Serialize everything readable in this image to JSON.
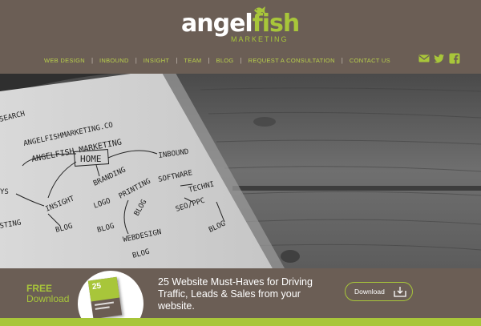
{
  "brand": {
    "name_part1": "angel",
    "name_part2": "fish",
    "tagline": "MARKETING",
    "accent_color": "#a8c63a",
    "bg_color": "#6b5e55"
  },
  "nav": {
    "items": [
      {
        "label": "WEB DESIGN"
      },
      {
        "label": "INBOUND"
      },
      {
        "label": "INSIGHT"
      },
      {
        "label": "TEAM"
      },
      {
        "label": "BLOG"
      },
      {
        "label": "REQUEST A CONSULTATION"
      },
      {
        "label": "CONTACT US"
      }
    ],
    "separator": "|"
  },
  "social": {
    "icons": [
      "envelope-icon",
      "twitter-icon",
      "facebook-icon"
    ]
  },
  "hero": {
    "notebook_text": {
      "url": "ANGELFISHMARKETING.CO",
      "title": "ANGELFISH MARKETING",
      "home": "HOME",
      "branding": "BRANDING",
      "inbound": "INBOUND",
      "software": "SOFTWARE",
      "technical": "TECHNI",
      "seo_ppc": "SEO/PPC",
      "insight": "INSIGHT",
      "logo": "LOGO",
      "printing": "PRINTING",
      "blog": "BLOG",
      "webdesign": "WEBDESIGN",
      "search": "SEARCH",
      "ys": "YS",
      "sting": "STING"
    }
  },
  "banner": {
    "free": "FREE",
    "download": "Download",
    "book_number": "25",
    "promo": "25 Website Must-Haves for Driving Traffic, Leads & Sales from your website.",
    "button_label": "Download"
  }
}
